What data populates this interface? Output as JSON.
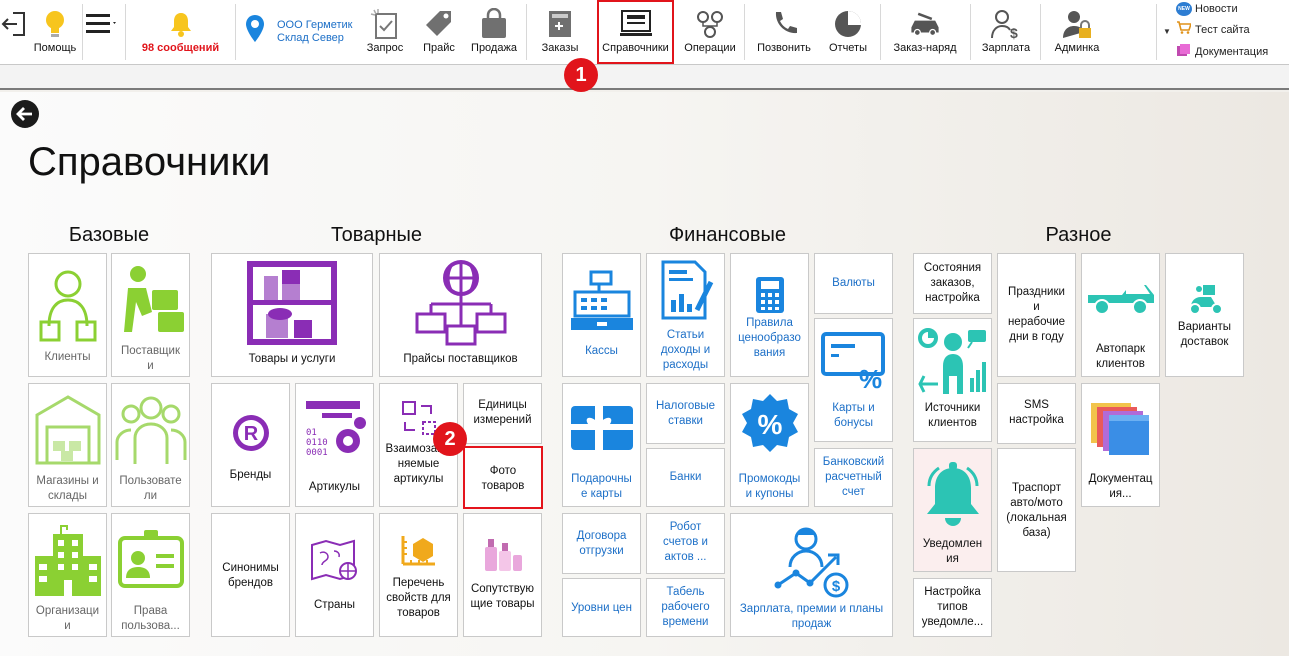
{
  "toolbar": {
    "help": "Помощь",
    "messages": "98 сообщений",
    "company": [
      "ООО Герметик",
      "Склад Север"
    ],
    "request": "Запрос",
    "price": "Прайс",
    "sale": "Продажа",
    "orders": "Заказы",
    "directories": "Справочники",
    "operations": "Операции",
    "call": "Позвонить",
    "reports": "Отчеты",
    "work_order": "Заказ-наряд",
    "salary": "Зарплата",
    "admin": "Админка",
    "news": "Новости",
    "test_site": "Тест сайта",
    "docs": "Документация",
    "news_badge": "NEW"
  },
  "page": {
    "title": "Справочники",
    "groups": [
      "Базовые",
      "Товарные",
      "Финансовые",
      "Разное"
    ]
  },
  "tiles": {
    "clients": "Клиенты",
    "suppliers": "Поставщик\nи",
    "shops": "Магазины и\nсклады",
    "users": "Пользовате\nли",
    "orgs": "Организаци\nи",
    "rights": "Права\nпользова...",
    "goods": "Товары и услуги",
    "supplier_prices": "Прайсы поставщиков",
    "brands": "Бренды",
    "articles": "Артикулы",
    "interchangeable": "Взаимозаме\nняемые\nартикулы",
    "units": "Единицы\nизмерений",
    "photos": "Фото\nтоваров",
    "brand_synonyms": "Синонимы\nбрендов",
    "countries": "Страны",
    "properties": "Перечень\nсвойств для\nтоваров",
    "related": "Сопутствую\nщие товары",
    "cashboxes": "Кассы",
    "income_items": "Статьи\nдоходы и\nрасходы",
    "pricing_rules": "Правила\nценообразо\nвания",
    "currencies": "Валюты",
    "cards_bonuses": "Карты и\nбонусы",
    "gift_cards": "Подарочны\nе карты",
    "tax_rates": "Налоговые\nставки",
    "banks": "Банки",
    "promo": "Промокоды\nи купоны",
    "bank_account": "Банковский\nрасчетный\nсчет",
    "shipment_contracts": "Договора\nотгрузки",
    "robot": "Робот\nсчетов и\nактов ...",
    "price_levels": "Уровни цен",
    "timesheet": "Табель\nрабочего\nвремени",
    "salary_tile": "Зарплата, премии и планы\nпродаж",
    "order_states": "Состояния\nзаказов,\nнастройка",
    "holidays": "Праздники\nи\nнерабочие\nдни в году",
    "fleet": "Автопарк\nклиентов",
    "delivery": "Варианты\nдоставок",
    "sources": "Источники\nклиентов",
    "sms": "SMS\nнастройка",
    "documentation": "Документац\nия...",
    "notifications": "Уведомлен\nия",
    "transport": "Траспорт\nавто/мото\n(локальная\nбаза)",
    "notify_types": "Настройка\nтипов\nуведомле..."
  },
  "markers": [
    "1",
    "2"
  ],
  "colors": {
    "green": "#8bd033",
    "purple": "#8a2db5",
    "blue": "#1a85de",
    "teal": "#2cc4b4",
    "alert": "#e1141b"
  }
}
